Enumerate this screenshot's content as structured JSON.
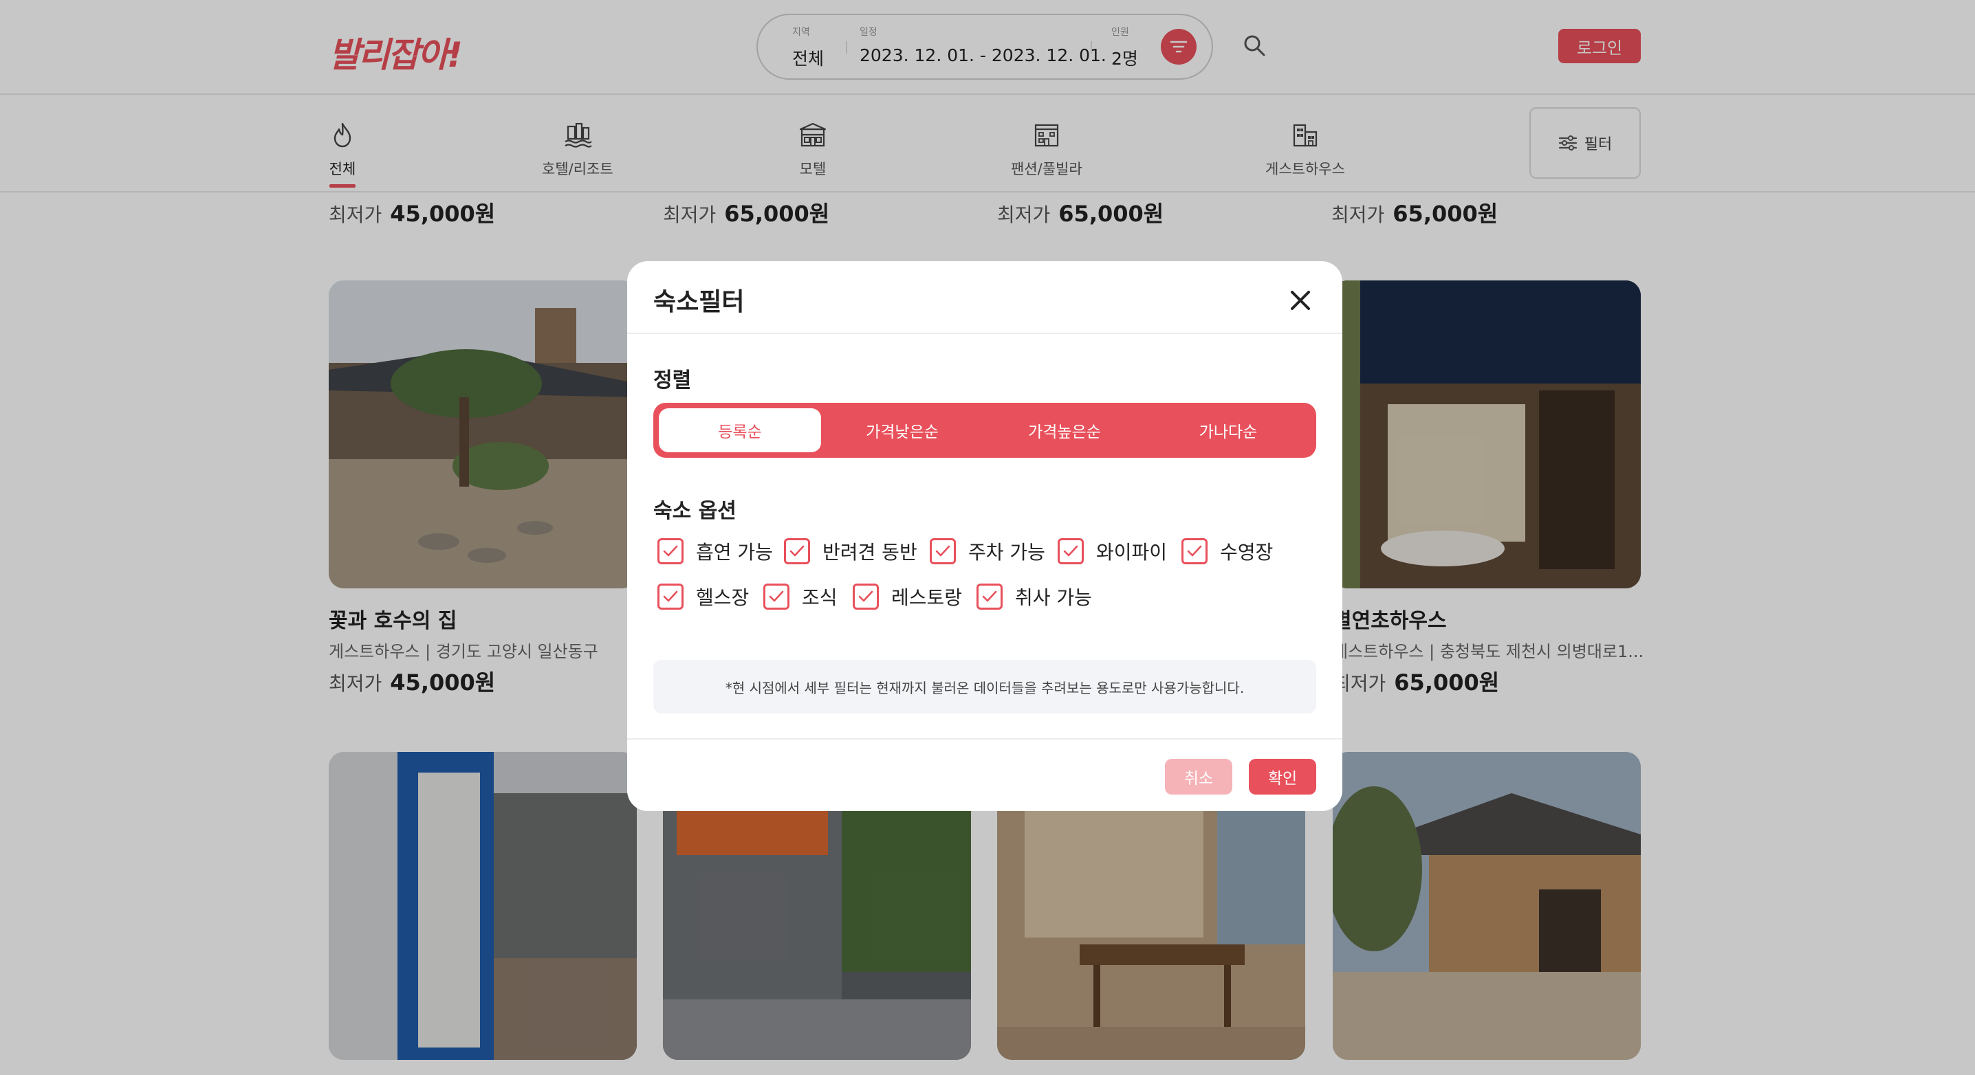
{
  "header": {
    "logo": "발리잡아!",
    "search": {
      "region_label": "지역",
      "region_value": "전체",
      "date_label": "일정",
      "date_value": "2023. 12. 01. - 2023. 12. 01.",
      "guests_label": "인원",
      "guests_value": "2명"
    },
    "login_label": "로그인"
  },
  "categories": [
    {
      "label": "전체",
      "icon": "flame-icon",
      "active": true
    },
    {
      "label": "호텔/리조트",
      "icon": "hotel-resort-icon",
      "active": false
    },
    {
      "label": "모텔",
      "icon": "motel-icon",
      "active": false
    },
    {
      "label": "팬션/풀빌라",
      "icon": "pension-icon",
      "active": false
    },
    {
      "label": "게스트하우스",
      "icon": "guesthouse-icon",
      "active": false
    }
  ],
  "filter_button_label": "필터",
  "price_prefix": "최저가",
  "top_prices": [
    "45,000원",
    "65,000원",
    "65,000원",
    "65,000원"
  ],
  "cards": [
    {
      "title": "꽃과 호수의 집",
      "subtitle": "게스트하우스 | 경기도 고양시 일산동구",
      "price": "45,000원"
    },
    {
      "title": "별연초하우스",
      "subtitle": "게스트하우스 | 충청북도 제천시 의병대로1...",
      "price": "65,000원"
    }
  ],
  "modal": {
    "title": "숙소필터",
    "sort_title": "정렬",
    "sort_options": [
      "등록순",
      "가격낮은순",
      "가격높은순",
      "가나다순"
    ],
    "sort_selected": "등록순",
    "options_title": "숙소 옵션",
    "options": [
      {
        "label": "흡연 가능",
        "checked": true
      },
      {
        "label": "반려견 동반",
        "checked": true
      },
      {
        "label": "주차 가능",
        "checked": true
      },
      {
        "label": "와이파이",
        "checked": true
      },
      {
        "label": "수영장",
        "checked": true
      },
      {
        "label": "헬스장",
        "checked": true
      },
      {
        "label": "조식",
        "checked": true
      },
      {
        "label": "레스토랑",
        "checked": true
      },
      {
        "label": "취사 가능",
        "checked": true
      }
    ],
    "notice": "*현 시점에서 세부 필터는 현재까지 불러온 데이터들을 추려보는 용도로만 사용가능합니다.",
    "cancel_label": "취소",
    "confirm_label": "확인"
  },
  "colors": {
    "accent": "#e8505b",
    "accent_light": "#f5b3b8",
    "notice_bg": "#f2f4f7"
  }
}
